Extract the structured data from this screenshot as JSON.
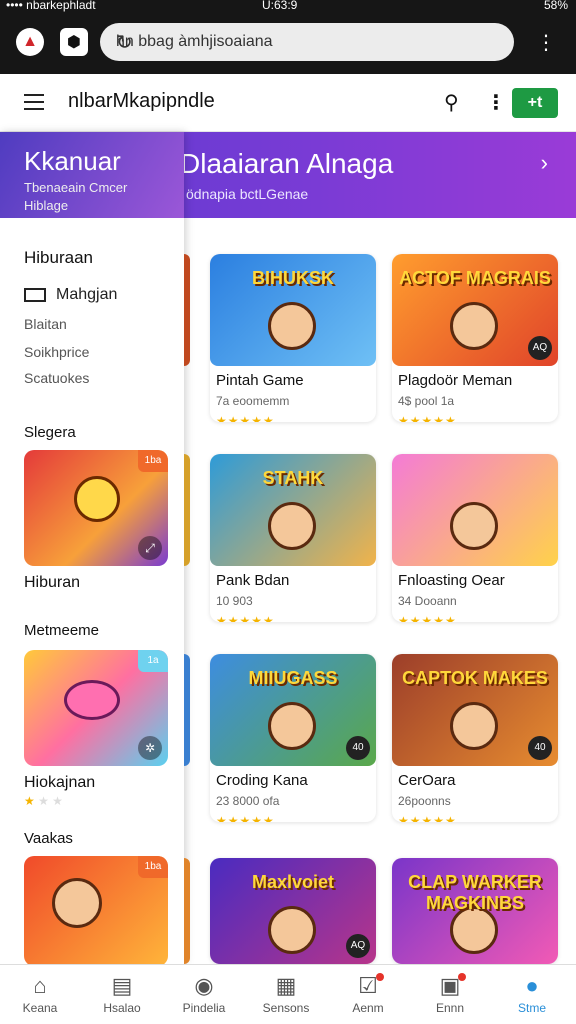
{
  "status": {
    "left": "•••• nbarkephladt",
    "center": "U:63:9",
    "right": "58%"
  },
  "browser": {
    "url": "hn bbag àmhjisoaiana"
  },
  "header": {
    "title": "nlbarMkapipndle",
    "action_label": "+t"
  },
  "banner": {
    "title": "Dlaaiaran Alnaga",
    "subtitle": "ödnapia bctLGenae"
  },
  "drawer": {
    "title": "Kkanuar",
    "subtitle1": "Tbenaeain Cmcer",
    "subtitle2": "Hiblage",
    "section1": "Hiburaan",
    "items": [
      "Mahgjan",
      "Blaitan",
      "Soikhprice",
      "Scatuokes"
    ],
    "section2": "Slegera",
    "card1": {
      "tag": "1ba",
      "caption": "Hiburan"
    },
    "section3": "Metmeeme",
    "card2": {
      "tag": "1a",
      "caption": "Hiokajnan"
    },
    "section4": "Vaakas",
    "card3": {
      "tag": "1ba"
    }
  },
  "games": [
    {
      "title": "Pintah Game",
      "sub": "7a eoomemm",
      "rating": "★★★★★",
      "art_text": "BIHUKSK",
      "badge": "",
      "colors": [
        "#2b7fe0",
        "#6fc0f5"
      ]
    },
    {
      "title": "Plagdoör Meman",
      "sub": "4$ pool 1a",
      "rating": "★★★★★",
      "art_text": "ACTOF MAGRAIS",
      "badge": "AQ",
      "colors": [
        "#ff9d2e",
        "#e0442a"
      ]
    },
    {
      "title": "Pank Bdan",
      "sub": "10 903",
      "rating": "★★★★★",
      "art_text": "STAHK",
      "badge": "",
      "colors": [
        "#2e9bd8",
        "#f1b34a"
      ]
    },
    {
      "title": "Fnloasting Oear",
      "sub": "34 Dooann",
      "rating": "★★★★★",
      "art_text": "",
      "badge": "",
      "colors": [
        "#f47bd6",
        "#ffd24a"
      ]
    },
    {
      "title": "Croding Kana",
      "sub": "23 8000 ofa",
      "rating": "★★★★★",
      "art_text": "MIIUGASS",
      "badge": "40",
      "colors": [
        "#3d8de0",
        "#5aa84a"
      ]
    },
    {
      "title": "CerOara",
      "sub": "26poonns",
      "rating": "★★★★★",
      "art_text": "CAPTOK MAKES",
      "badge": "40",
      "colors": [
        "#9c3e2a",
        "#e78c30"
      ]
    },
    {
      "title": "",
      "sub": "",
      "rating": "",
      "art_text": "Maxlvoiet",
      "badge": "AQ",
      "colors": [
        "#4a2bc0",
        "#b7358a"
      ]
    },
    {
      "title": "",
      "sub": "",
      "rating": "",
      "art_text": "CLAP WARKER MAGKINBS",
      "badge": "",
      "colors": [
        "#7a35c9",
        "#f25ab5"
      ]
    }
  ],
  "nav": [
    {
      "label": "Keana",
      "icon": "home-icon"
    },
    {
      "label": "Hsalao",
      "icon": "clipboard-icon"
    },
    {
      "label": "Pindelia",
      "icon": "compass-icon"
    },
    {
      "label": "Sensons",
      "icon": "calendar-icon"
    },
    {
      "label": "Aenm",
      "icon": "check-square-icon"
    },
    {
      "label": "Ennn",
      "icon": "chart-icon"
    },
    {
      "label": "Stme",
      "icon": "person-icon"
    }
  ],
  "colors": {
    "accent": "#2a8fd8",
    "green": "#1e9a43",
    "banner": "#6a3bd3"
  }
}
